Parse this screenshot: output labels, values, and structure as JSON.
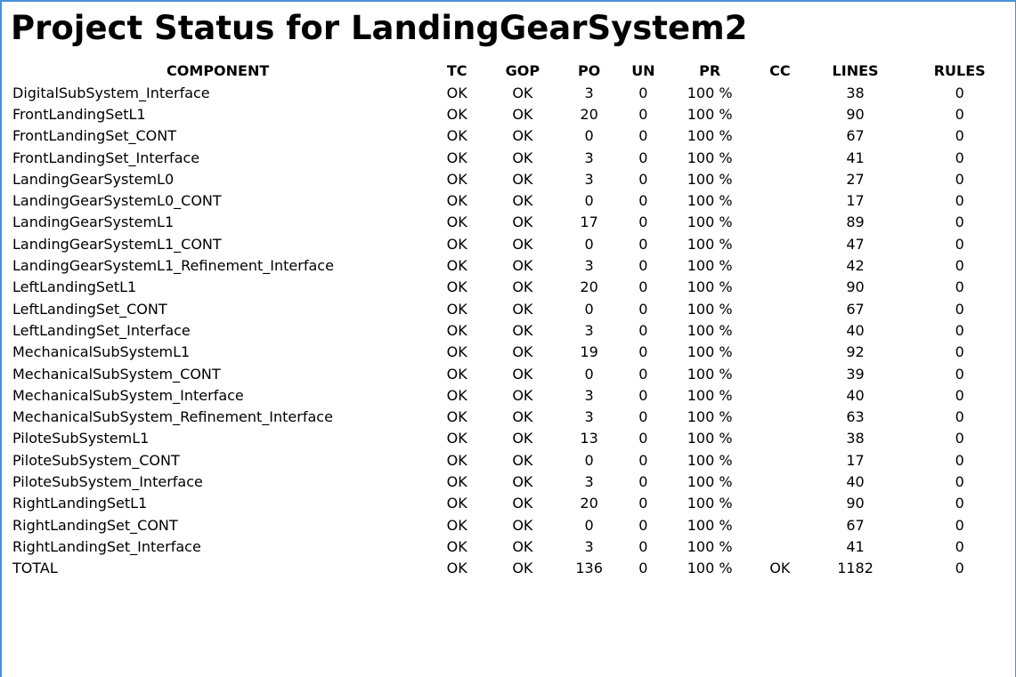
{
  "report": {
    "title": "Project Status for LandingGearSystem2"
  },
  "table": {
    "headers": {
      "component": "COMPONENT",
      "tc": "TC",
      "gop": "GOP",
      "po": "PO",
      "un": "UN",
      "pr": "PR",
      "cc": "CC",
      "lines": "LINES",
      "rules": "RULES"
    },
    "rows": [
      {
        "component": "DigitalSubSystem_Interface",
        "tc": "OK",
        "gop": "OK",
        "po": "3",
        "un": "0",
        "pr": "100 %",
        "cc": "",
        "lines": "38",
        "rules": "0"
      },
      {
        "component": "FrontLandingSetL1",
        "tc": "OK",
        "gop": "OK",
        "po": "20",
        "un": "0",
        "pr": "100 %",
        "cc": "",
        "lines": "90",
        "rules": "0"
      },
      {
        "component": "FrontLandingSet_CONT",
        "tc": "OK",
        "gop": "OK",
        "po": "0",
        "un": "0",
        "pr": "100 %",
        "cc": "",
        "lines": "67",
        "rules": "0"
      },
      {
        "component": "FrontLandingSet_Interface",
        "tc": "OK",
        "gop": "OK",
        "po": "3",
        "un": "0",
        "pr": "100 %",
        "cc": "",
        "lines": "41",
        "rules": "0"
      },
      {
        "component": "LandingGearSystemL0",
        "tc": "OK",
        "gop": "OK",
        "po": "3",
        "un": "0",
        "pr": "100 %",
        "cc": "",
        "lines": "27",
        "rules": "0"
      },
      {
        "component": "LandingGearSystemL0_CONT",
        "tc": "OK",
        "gop": "OK",
        "po": "0",
        "un": "0",
        "pr": "100 %",
        "cc": "",
        "lines": "17",
        "rules": "0"
      },
      {
        "component": "LandingGearSystemL1",
        "tc": "OK",
        "gop": "OK",
        "po": "17",
        "un": "0",
        "pr": "100 %",
        "cc": "",
        "lines": "89",
        "rules": "0"
      },
      {
        "component": "LandingGearSystemL1_CONT",
        "tc": "OK",
        "gop": "OK",
        "po": "0",
        "un": "0",
        "pr": "100 %",
        "cc": "",
        "lines": "47",
        "rules": "0"
      },
      {
        "component": "LandingGearSystemL1_Refinement_Interface",
        "tc": "OK",
        "gop": "OK",
        "po": "3",
        "un": "0",
        "pr": "100 %",
        "cc": "",
        "lines": "42",
        "rules": "0"
      },
      {
        "component": "LeftLandingSetL1",
        "tc": "OK",
        "gop": "OK",
        "po": "20",
        "un": "0",
        "pr": "100 %",
        "cc": "",
        "lines": "90",
        "rules": "0"
      },
      {
        "component": "LeftLandingSet_CONT",
        "tc": "OK",
        "gop": "OK",
        "po": "0",
        "un": "0",
        "pr": "100 %",
        "cc": "",
        "lines": "67",
        "rules": "0"
      },
      {
        "component": "LeftLandingSet_Interface",
        "tc": "OK",
        "gop": "OK",
        "po": "3",
        "un": "0",
        "pr": "100 %",
        "cc": "",
        "lines": "40",
        "rules": "0"
      },
      {
        "component": "MechanicalSubSystemL1",
        "tc": "OK",
        "gop": "OK",
        "po": "19",
        "un": "0",
        "pr": "100 %",
        "cc": "",
        "lines": "92",
        "rules": "0"
      },
      {
        "component": "MechanicalSubSystem_CONT",
        "tc": "OK",
        "gop": "OK",
        "po": "0",
        "un": "0",
        "pr": "100 %",
        "cc": "",
        "lines": "39",
        "rules": "0"
      },
      {
        "component": "MechanicalSubSystem_Interface",
        "tc": "OK",
        "gop": "OK",
        "po": "3",
        "un": "0",
        "pr": "100 %",
        "cc": "",
        "lines": "40",
        "rules": "0"
      },
      {
        "component": "MechanicalSubSystem_Refinement_Interface",
        "tc": "OK",
        "gop": "OK",
        "po": "3",
        "un": "0",
        "pr": "100 %",
        "cc": "",
        "lines": "63",
        "rules": "0"
      },
      {
        "component": "PiloteSubSystemL1",
        "tc": "OK",
        "gop": "OK",
        "po": "13",
        "un": "0",
        "pr": "100 %",
        "cc": "",
        "lines": "38",
        "rules": "0"
      },
      {
        "component": "PiloteSubSystem_CONT",
        "tc": "OK",
        "gop": "OK",
        "po": "0",
        "un": "0",
        "pr": "100 %",
        "cc": "",
        "lines": "17",
        "rules": "0"
      },
      {
        "component": "PiloteSubSystem_Interface",
        "tc": "OK",
        "gop": "OK",
        "po": "3",
        "un": "0",
        "pr": "100 %",
        "cc": "",
        "lines": "40",
        "rules": "0"
      },
      {
        "component": "RightLandingSetL1",
        "tc": "OK",
        "gop": "OK",
        "po": "20",
        "un": "0",
        "pr": "100 %",
        "cc": "",
        "lines": "90",
        "rules": "0"
      },
      {
        "component": "RightLandingSet_CONT",
        "tc": "OK",
        "gop": "OK",
        "po": "0",
        "un": "0",
        "pr": "100 %",
        "cc": "",
        "lines": "67",
        "rules": "0"
      },
      {
        "component": "RightLandingSet_Interface",
        "tc": "OK",
        "gop": "OK",
        "po": "3",
        "un": "0",
        "pr": "100 %",
        "cc": "",
        "lines": "41",
        "rules": "0"
      }
    ],
    "total": {
      "component": "TOTAL",
      "tc": "OK",
      "gop": "OK",
      "po": "136",
      "un": "0",
      "pr": "100 %",
      "cc": "OK",
      "lines": "1182",
      "rules": "0"
    }
  },
  "colors": {
    "frame_border": "#4a8fd6",
    "text": "#000000",
    "background": "#ffffff"
  }
}
